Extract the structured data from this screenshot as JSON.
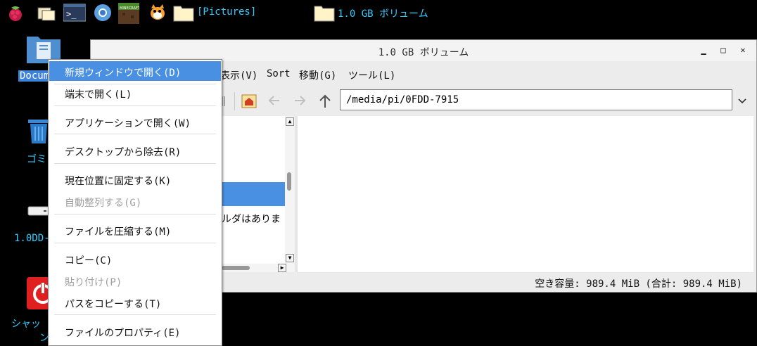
{
  "taskbar": {
    "items": [
      {
        "icon": "raspberry-icon"
      },
      {
        "icon": "file-manager-icon"
      },
      {
        "icon": "terminal-icon"
      },
      {
        "icon": "chromium-icon"
      },
      {
        "icon": "minecraft-icon"
      },
      {
        "icon": "scratch-icon"
      },
      {
        "icon": "folder-icon",
        "label": "[Pictures]"
      },
      {
        "icon": "folder-icon",
        "label": "1.0 GB ボリューム"
      }
    ]
  },
  "desktop": {
    "icons": [
      {
        "label": "Docum",
        "icon": "documents-icon",
        "selected": true
      },
      {
        "label": "ゴミ",
        "icon": "trash-icon"
      },
      {
        "label": "1.0DD-",
        "icon": "drive-icon"
      },
      {
        "label": "シャッ",
        "label2": "ン",
        "icon": "shutdown-icon"
      }
    ]
  },
  "window": {
    "title": "1.0 GB ボリューム",
    "controls": {
      "minimize": "▁",
      "maximize": "□",
      "close": "✕"
    },
    "menu": [
      "表示(V)",
      "Sort",
      "移動(G)",
      "ツール(L)"
    ],
    "path": "/media/pi/0FDD-7915",
    "sidebar_text": "ルダはありま",
    "status": "空き容量: 989.4 MiB (合計: 989.4 MiB)"
  },
  "context_menu": {
    "items": [
      {
        "label": "新規ウィンドウで開く(D)",
        "highlighted": true
      },
      {
        "label": "端末で開く(L)"
      },
      {
        "label": "アプリケーションで開く(W)"
      },
      {
        "label": "デスクトップから除去(R)"
      },
      {
        "label": "現在位置に固定する(K)"
      },
      {
        "label": "自動整列する(G)",
        "disabled": true
      },
      {
        "label": "ファイルを圧縮する(M)"
      },
      {
        "label": "コピー(C)"
      },
      {
        "label": "貼り付け(P)",
        "disabled": true
      },
      {
        "label": "パスをコピーする(T)"
      },
      {
        "label": "ファイルのプロパティ(E)"
      }
    ]
  },
  "colors": {
    "accent": "#4a90e2",
    "desktop_text": "#33ccff",
    "desktop_bg": "#000000"
  }
}
